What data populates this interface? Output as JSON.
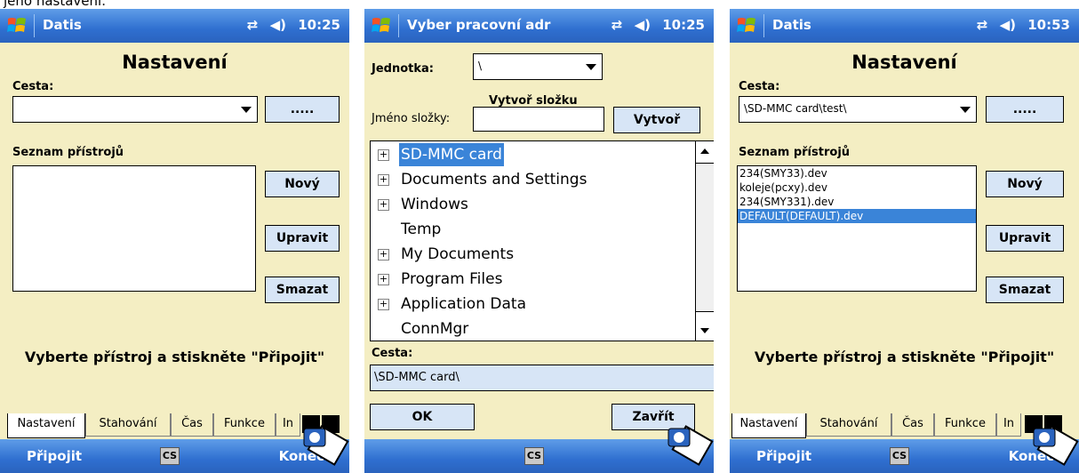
{
  "caption": "jeho nastavení.",
  "colors": {
    "titlebar": "#2f6fd0",
    "background": "#f4eec3",
    "selection": "#3a84d8",
    "button": "#d7e5f6"
  },
  "screen1": {
    "titlebar": {
      "title": "Datis",
      "time": "10:25"
    },
    "heading": "Nastavení",
    "path_label": "Cesta:",
    "path_value": "",
    "browse_button": ".....",
    "list_label": "Seznam přístrojů",
    "devices": [],
    "buttons": {
      "new": "Nový",
      "edit": "Upravit",
      "delete": "Smazat"
    },
    "instruction": "Vyberte přístroj a stiskněte \"Připojit\"",
    "tabs": [
      "Nastavení",
      "Stahování",
      "Čas",
      "Funkce",
      "In"
    ],
    "menu": {
      "left": "Připojit",
      "center": "CS",
      "right": "Konec"
    }
  },
  "screen2": {
    "titlebar": {
      "title": "Vyber pracovní adr",
      "time": "10:25"
    },
    "unit_label": "Jednotka:",
    "unit_value": "\\",
    "create_folder_label": "Vytvoř složku",
    "folder_name_label": "Jméno složky:",
    "folder_name_value": "",
    "create_button": "Vytvoř",
    "tree_items": [
      {
        "label": "SD-MMC card",
        "expandable": true,
        "selected": true
      },
      {
        "label": "Documents and Settings",
        "expandable": true,
        "selected": false
      },
      {
        "label": "Windows",
        "expandable": true,
        "selected": false
      },
      {
        "label": "Temp",
        "expandable": false,
        "selected": false
      },
      {
        "label": "My Documents",
        "expandable": true,
        "selected": false
      },
      {
        "label": "Program Files",
        "expandable": true,
        "selected": false
      },
      {
        "label": "Application Data",
        "expandable": true,
        "selected": false
      },
      {
        "label": "ConnMgr",
        "expandable": false,
        "selected": false
      }
    ],
    "path_label": "Cesta:",
    "path_value": "\\SD-MMC card\\",
    "ok_button": "OK",
    "close_button": "Zavřít",
    "menu": {
      "center": "CS"
    }
  },
  "screen3": {
    "titlebar": {
      "title": "Datis",
      "time": "10:53"
    },
    "heading": "Nastavení",
    "path_label": "Cesta:",
    "path_value": "\\SD-MMC card\\test\\",
    "browse_button": ".....",
    "list_label": "Seznam přístrojů",
    "devices": [
      "234(SMY33).dev",
      "koleje(pcxy).dev",
      "234(SMY331).dev",
      "DEFAULT(DEFAULT).dev"
    ],
    "selected_device": 3,
    "buttons": {
      "new": "Nový",
      "edit": "Upravit",
      "delete": "Smazat"
    },
    "instruction": "Vyberte přístroj a stiskněte \"Připojit\"",
    "tabs": [
      "Nastavení",
      "Stahování",
      "Čas",
      "Funkce",
      "In"
    ],
    "menu": {
      "left": "Připojit",
      "center": "CS",
      "right": "Konec"
    }
  }
}
